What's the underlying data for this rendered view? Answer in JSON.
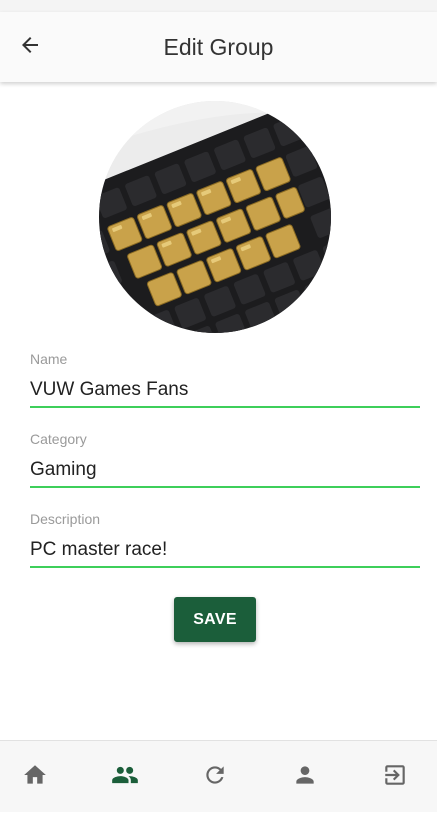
{
  "header": {
    "title": "Edit Group",
    "back_icon": "arrow-back-icon"
  },
  "group_image": {
    "alt": "Mechanical keyboard with gold keycaps",
    "icon": "group-photo"
  },
  "form": {
    "name": {
      "label": "Name",
      "value": "VUW Games Fans"
    },
    "category": {
      "label": "Category",
      "value": "Gaming"
    },
    "description": {
      "label": "Description",
      "value": "PC master race!"
    },
    "save_label": "SAVE"
  },
  "bottom_nav": {
    "items": [
      {
        "icon": "home-icon"
      },
      {
        "icon": "groups-icon",
        "active": true
      },
      {
        "icon": "refresh-icon"
      },
      {
        "icon": "person-icon"
      },
      {
        "icon": "logout-icon"
      }
    ]
  },
  "colors": {
    "accent_underline": "#3ecf5a",
    "primary": "#1b5e3a",
    "nav_icon": "#666666"
  }
}
